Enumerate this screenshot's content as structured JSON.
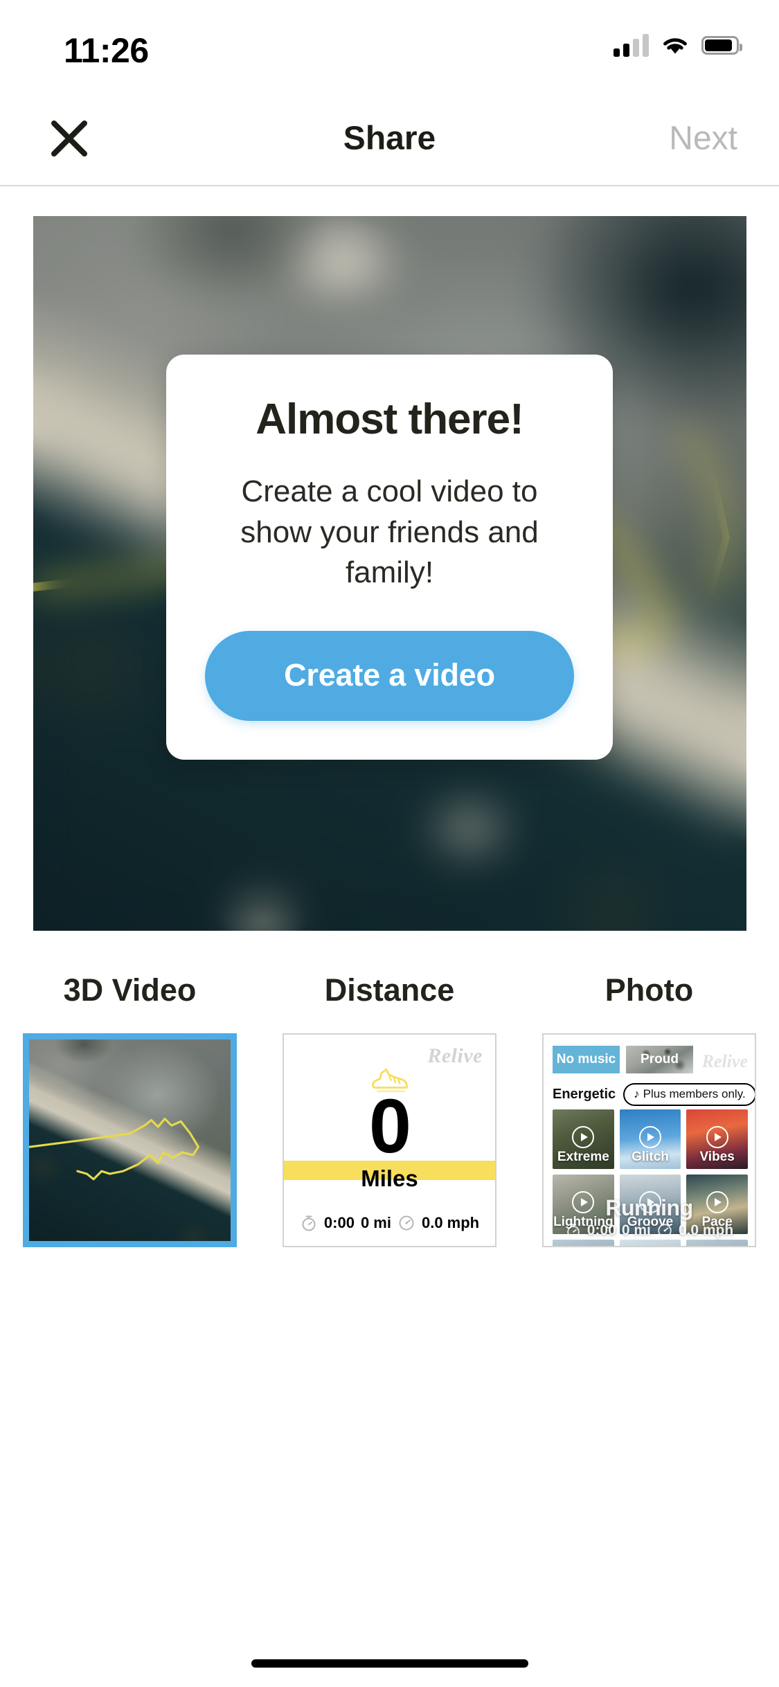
{
  "status_bar": {
    "time": "11:26",
    "cellular_icon": "cellular-bars-icon",
    "wifi_icon": "wifi-icon",
    "battery_icon": "battery-icon"
  },
  "nav_bar": {
    "close_icon": "close-x-icon",
    "title": "Share",
    "next_label": "Next",
    "next_enabled": false
  },
  "hero": {
    "type": "blurred-satellite-map-preview",
    "track_color": "#e2d648"
  },
  "modal": {
    "title": "Almost there!",
    "body": "Create a cool video to show your friends and family!",
    "cta_label": "Create a video",
    "cta_color": "#4fabe2"
  },
  "templates": [
    {
      "label": "3D Video",
      "selected": true,
      "kind": "map"
    },
    {
      "label": "Distance",
      "selected": false,
      "kind": "distance",
      "card": {
        "brand": "Relive",
        "shoe_icon": "running-shoe-icon",
        "value": "0",
        "unit": "Miles",
        "band_color": "#f7de5c",
        "stats": [
          {
            "icon": "stopwatch-icon",
            "value": "0:00"
          },
          {
            "icon": null,
            "value": "0 mi"
          },
          {
            "icon": "speedometer-icon",
            "value": "0.0 mph"
          }
        ]
      }
    },
    {
      "label": "Photo",
      "selected": false,
      "kind": "music",
      "card": {
        "brand": "Relive",
        "chips": [
          {
            "label": "No music",
            "selected": true
          },
          {
            "label": "Proud",
            "selected": false
          }
        ],
        "genre": "Energetic",
        "plus_pill": {
          "note_icon": "music-note-icon",
          "label": "Plus members only."
        },
        "tracks": [
          {
            "name": "Extreme",
            "play_icon": "play-circle-icon"
          },
          {
            "name": "Glitch",
            "play_icon": "play-circle-icon"
          },
          {
            "name": "Vibes",
            "play_icon": "play-circle-icon"
          },
          {
            "name": "Lightning",
            "play_icon": "play-circle-icon"
          },
          {
            "name": "Groove",
            "play_icon": "play-circle-icon"
          },
          {
            "name": "Pace",
            "play_icon": "play-circle-icon"
          }
        ],
        "overlay": {
          "title": "Running",
          "stats": [
            {
              "icon": "stopwatch-icon",
              "value": "0:00"
            },
            {
              "icon": null,
              "value": "0 mi"
            },
            {
              "icon": "speedometer-icon",
              "value": "0.0 mph"
            }
          ]
        }
      }
    }
  ],
  "home_indicator": "home-indicator"
}
